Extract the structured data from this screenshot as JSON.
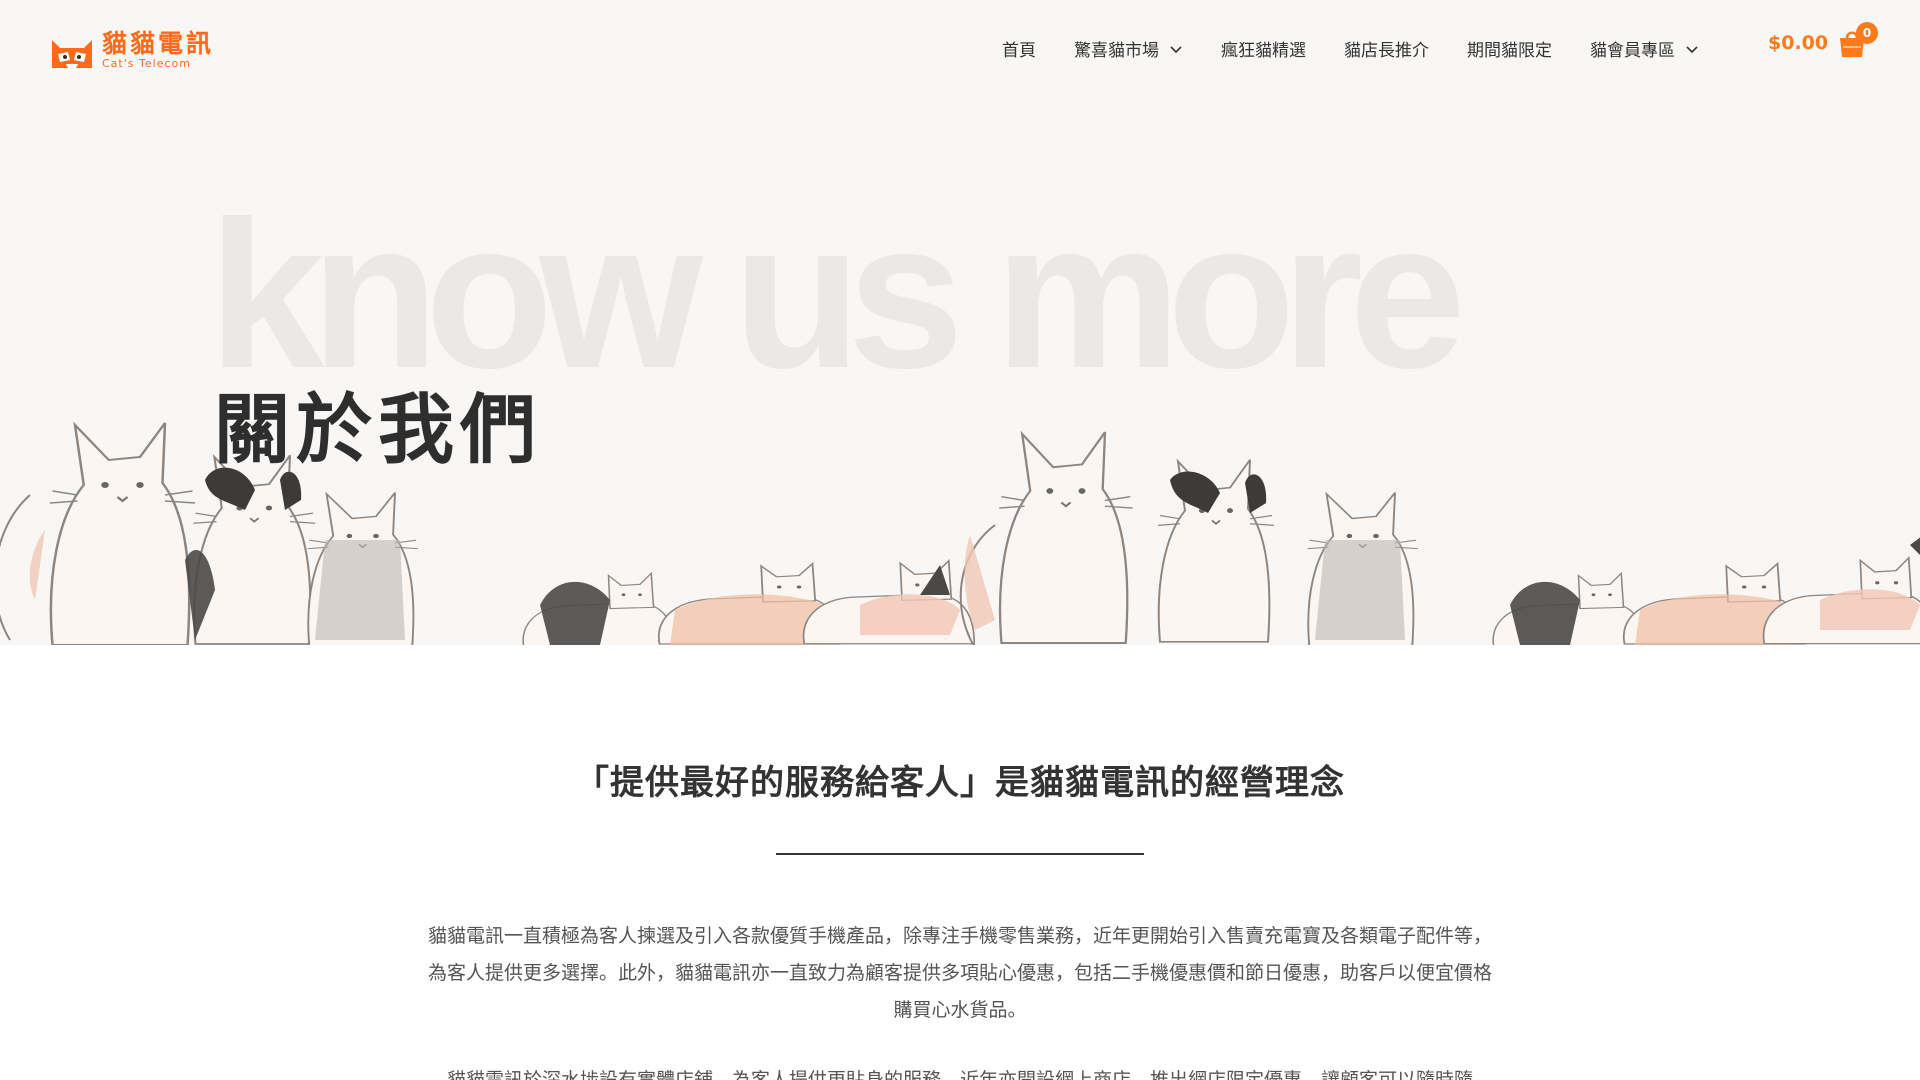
{
  "brand": {
    "name_cn": "貓貓電訊",
    "name_en": "Cat's Telecom",
    "accent_color": "#ff7a1a"
  },
  "nav": {
    "items": [
      {
        "label": "首頁",
        "has_dropdown": false
      },
      {
        "label": "驚喜貓市場",
        "has_dropdown": true
      },
      {
        "label": "瘋狂貓精選",
        "has_dropdown": false
      },
      {
        "label": "貓店長推介",
        "has_dropdown": false
      },
      {
        "label": "期間貓限定",
        "has_dropdown": false
      },
      {
        "label": "貓會員專區",
        "has_dropdown": true
      }
    ]
  },
  "cart": {
    "total": "$0.00",
    "count": "0",
    "icon": "shopping-bag-icon"
  },
  "hero": {
    "background_word": "know us more",
    "title": "關於我們"
  },
  "content": {
    "heading": "「提供最好的服務給客人」是貓貓電訊的經營理念",
    "paragraphs": [
      "貓貓電訊一直積極為客人揀選及引入各款優質手機產品，除專注手機零售業務，近年更開始引入售賣充電寶及各類電子配件等，為客人提供更多選擇。此外，貓貓電訊亦一直致力為顧客提供多項貼心優惠，包括二手機優惠價和節日優惠，助客戶以便宜價格購買心水貨品。",
      "貓貓電訊於深水埗設有實體店鋪，為客人提供更貼身的服務，近年亦開設網上商店，推出網店限定優惠，讓顧客可以隨時隨"
    ]
  }
}
